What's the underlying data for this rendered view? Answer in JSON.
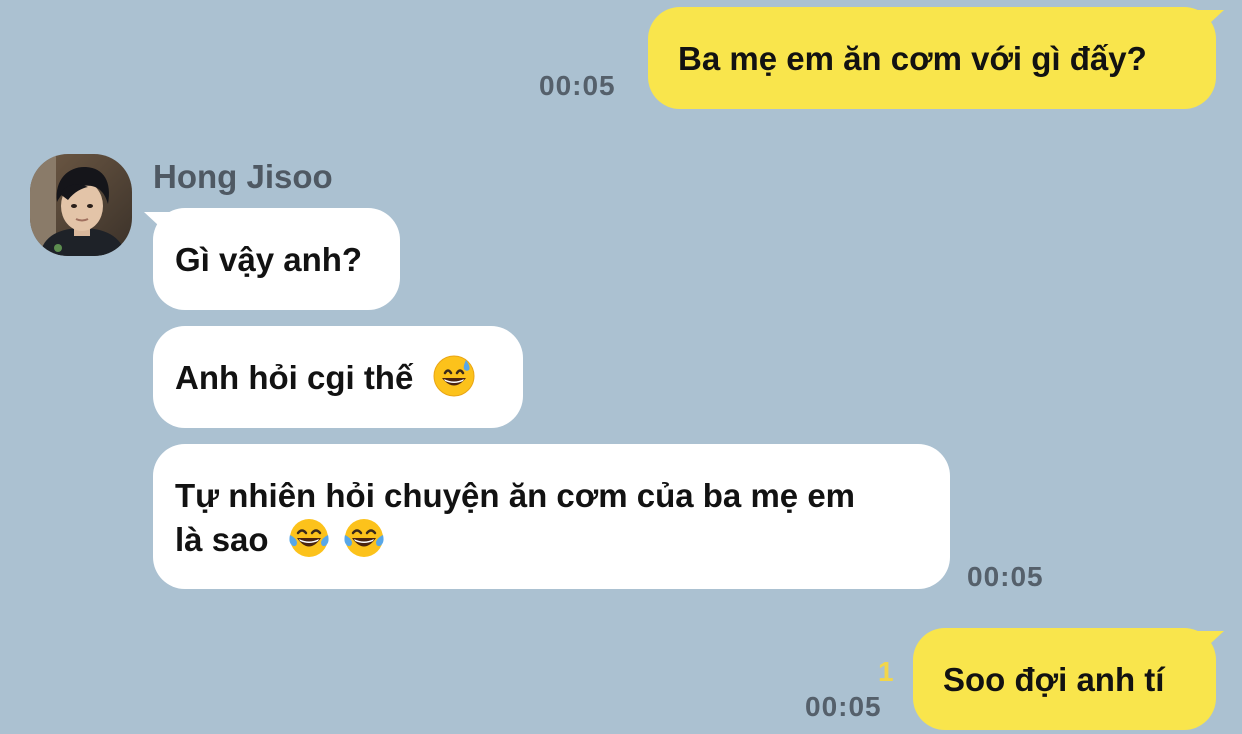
{
  "messages": [
    {
      "direction": "outgoing",
      "text": "Ba mẹ em ăn cơm với gì đấy?",
      "time": "00:05"
    },
    {
      "direction": "incoming",
      "sender": "Hong Jisoo",
      "text": "Gì vậy anh?"
    },
    {
      "direction": "incoming",
      "text": "Anh hỏi cgi thế",
      "emoji": [
        "grinning-face-with-sweat"
      ]
    },
    {
      "direction": "incoming",
      "lines": [
        "Tự nhiên hỏi chuyện ăn cơm của ba mẹ em",
        "là sao"
      ],
      "emoji": [
        "face-with-tears-of-joy",
        "face-with-tears-of-joy"
      ],
      "time": "00:05"
    },
    {
      "direction": "outgoing",
      "text": "Soo đợi anh tí",
      "time": "00:05",
      "unread_count": "1"
    }
  ],
  "colors": {
    "background": "#abc1d1",
    "outgoing_bubble": "#f9e54c",
    "incoming_bubble": "#ffffff",
    "timestamp": "#55606b",
    "unread": "#f2d64a"
  },
  "icons": [
    "avatar-photo",
    "grinning-face-with-sweat",
    "face-with-tears-of-joy"
  ]
}
